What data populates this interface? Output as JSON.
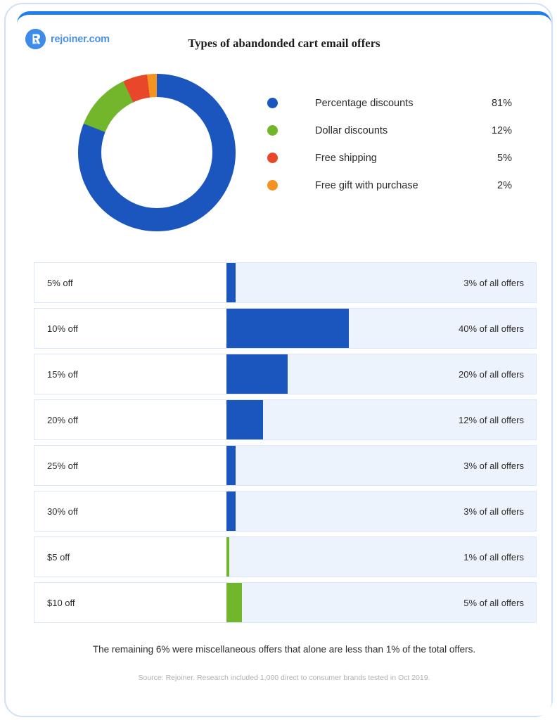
{
  "brand": {
    "logo_icon": "rejoiner-r-logo-icon",
    "logo_text": "rejoiner.com"
  },
  "header": {
    "title": "Types of abandonded cart email offers"
  },
  "colors": {
    "blue": "#1a56bd",
    "brand_blue": "#1b7df0",
    "green": "#72b62c",
    "red": "#e8472a",
    "orange": "#f59321",
    "track": "#edf3fc",
    "frame": "#cfe0f7"
  },
  "chart_data": [
    {
      "type": "pie",
      "title": "Types of abandonded cart email offers",
      "subtype": "donut",
      "legend_position": "right",
      "categories": [
        "Percentage discounts",
        "Dollar discounts",
        "Free shipping",
        "Free gift with purchase"
      ],
      "values": [
        81,
        12,
        5,
        2
      ],
      "value_labels": [
        "81%",
        "12%",
        "5%",
        "2%"
      ],
      "colors": [
        "#1a56bd",
        "#72b62c",
        "#e8472a",
        "#f59321"
      ]
    },
    {
      "type": "bar",
      "orientation": "horizontal",
      "categories": [
        "5% off",
        "10% off",
        "15% off",
        "20% off",
        "25% off",
        "30% off",
        "$5 off",
        "$10 off"
      ],
      "values": [
        3,
        40,
        20,
        12,
        3,
        3,
        1,
        5
      ],
      "value_labels": [
        "3% of all offers",
        "40% of all offers",
        "20% of all offers",
        "12% of all offers",
        "3% of all offers",
        "3% of all offers",
        "1% of all offers",
        "5% of all offers"
      ],
      "bar_colors": [
        "#1a56bd",
        "#1a56bd",
        "#1a56bd",
        "#1a56bd",
        "#1a56bd",
        "#1a56bd",
        "#72b62c",
        "#72b62c"
      ],
      "xlabel": "",
      "ylabel": "",
      "xlim": [
        0,
        100
      ],
      "grid": false
    }
  ],
  "legend": [
    {
      "label": "Percentage discounts",
      "value": "81%",
      "color": "#1a56bd"
    },
    {
      "label": "Dollar discounts",
      "value": "12%",
      "color": "#72b62c"
    },
    {
      "label": "Free shipping",
      "value": "5%",
      "color": "#e8472a"
    },
    {
      "label": "Free gift with purchase",
      "value": "2%",
      "color": "#f59321"
    }
  ],
  "bars": [
    {
      "label": "5% off",
      "value": "3% of all offers",
      "pct": 3,
      "color": "#1a56bd"
    },
    {
      "label": "10% off",
      "value": "40% of all offers",
      "pct": 40,
      "color": "#1a56bd"
    },
    {
      "label": "15% off",
      "value": "20% of all offers",
      "pct": 20,
      "color": "#1a56bd"
    },
    {
      "label": "20% off",
      "value": "12% of all offers",
      "pct": 12,
      "color": "#1a56bd"
    },
    {
      "label": "25% off",
      "value": "3% of all offers",
      "pct": 3,
      "color": "#1a56bd"
    },
    {
      "label": "30% off",
      "value": "3% of all offers",
      "pct": 3,
      "color": "#1a56bd"
    },
    {
      "label": "$5 off",
      "value": "1% of all offers",
      "pct": 1,
      "color": "#72b62c"
    },
    {
      "label": "$10 off",
      "value": "5% of all offers",
      "pct": 5,
      "color": "#72b62c"
    }
  ],
  "footer": {
    "note": "The remaining 6% were miscellaneous offers that alone are less than 1% of the total offers.",
    "source": "Source: Rejoiner. Research included 1,000 direct to consumer brands tested in Oct 2019."
  }
}
